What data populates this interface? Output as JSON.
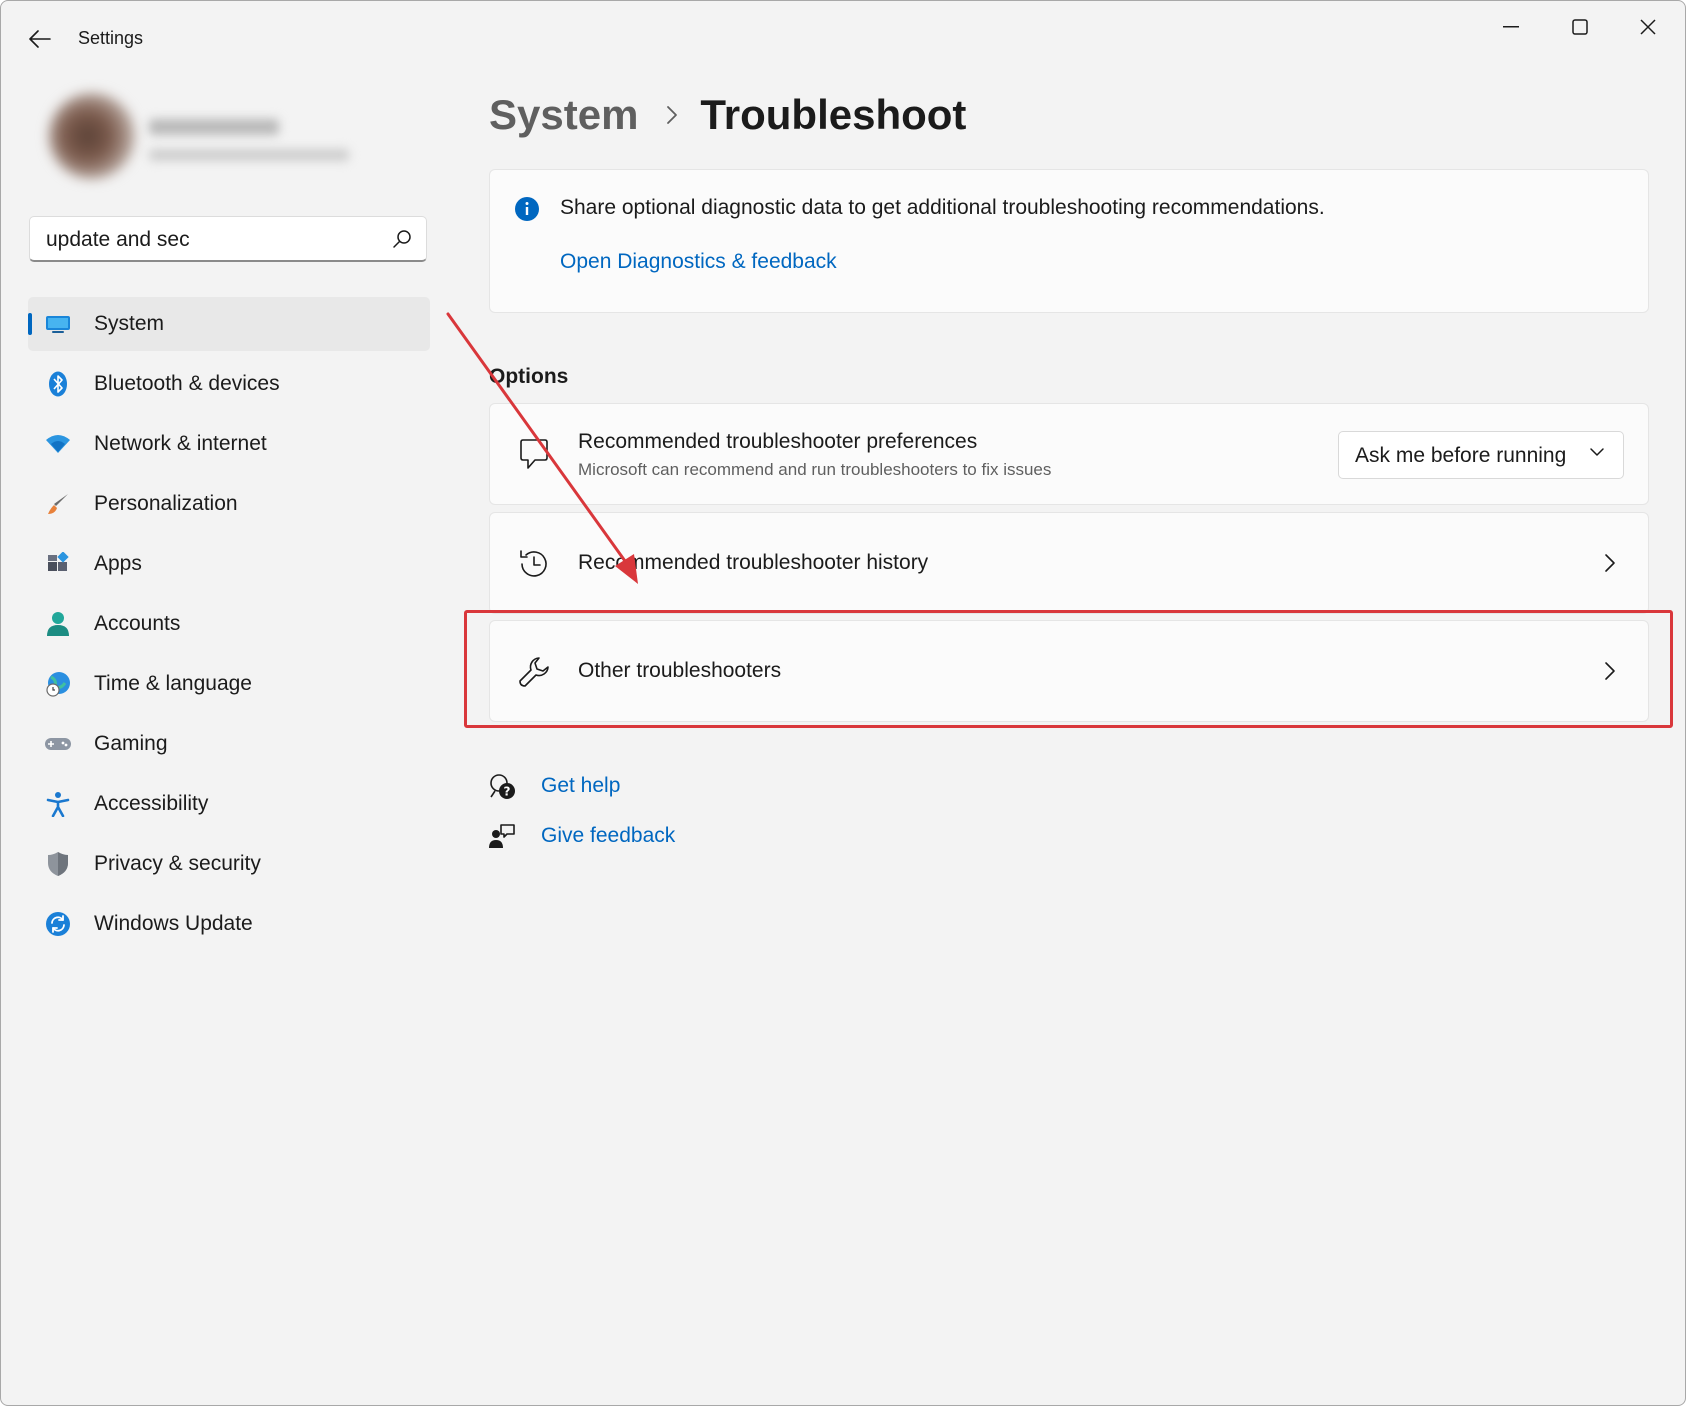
{
  "window": {
    "title": "Settings"
  },
  "search": {
    "value": "update and sec"
  },
  "sidebar": {
    "items": [
      {
        "label": "System",
        "icon": "system-display-icon",
        "active": true
      },
      {
        "label": "Bluetooth & devices",
        "icon": "bluetooth-icon"
      },
      {
        "label": "Network & internet",
        "icon": "wifi-icon"
      },
      {
        "label": "Personalization",
        "icon": "paintbrush-icon"
      },
      {
        "label": "Apps",
        "icon": "apps-icon"
      },
      {
        "label": "Accounts",
        "icon": "accounts-icon"
      },
      {
        "label": "Time & language",
        "icon": "globe-clock-icon"
      },
      {
        "label": "Gaming",
        "icon": "gamepad-icon"
      },
      {
        "label": "Accessibility",
        "icon": "accessibility-icon"
      },
      {
        "label": "Privacy & security",
        "icon": "shield-icon"
      },
      {
        "label": "Windows Update",
        "icon": "sync-icon"
      }
    ]
  },
  "breadcrumb": {
    "parent": "System",
    "current": "Troubleshoot"
  },
  "info": {
    "text": "Share optional diagnostic data to get additional troubleshooting recommendations.",
    "link": "Open Diagnostics & feedback"
  },
  "options": {
    "title": "Options",
    "preferences": {
      "title": "Recommended troubleshooter preferences",
      "subtitle": "Microsoft can recommend and run troubleshooters to fix issues",
      "dropdown_value": "Ask me before running"
    },
    "history": {
      "title": "Recommended troubleshooter history"
    },
    "other": {
      "title": "Other troubleshooters"
    }
  },
  "help": {
    "get_help": "Get help",
    "give_feedback": "Give feedback"
  },
  "colors": {
    "accent": "#0067c0",
    "annotation": "#d9373b",
    "background": "#f3f3f3",
    "card": "#fbfbfb"
  }
}
